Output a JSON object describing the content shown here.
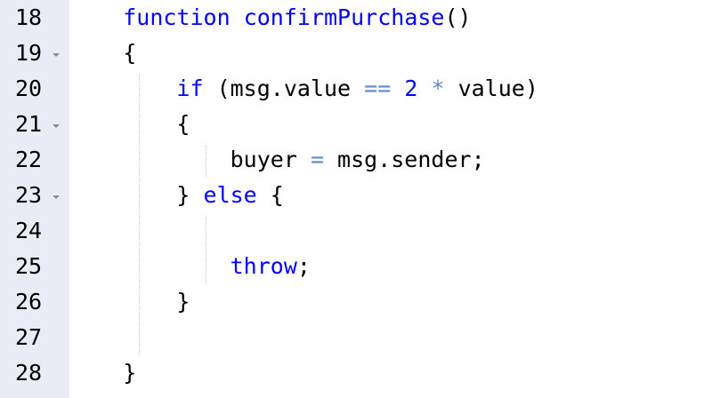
{
  "editor": {
    "colors": {
      "keyword": "#0000ff",
      "function_name": "#0000ff",
      "operator": "#5f8ac8",
      "number": "#0000ff",
      "plain": "#000000",
      "gutter_background": "#ebebf5",
      "fold_arrow": "#8c8c8c"
    },
    "lines": [
      {
        "number": "18",
        "fold": false,
        "tokens": [
          {
            "text": "    ",
            "type": "plain"
          },
          {
            "text": "function",
            "type": "keyword"
          },
          {
            "text": " ",
            "type": "plain"
          },
          {
            "text": "confirmPurchase",
            "type": "function_name"
          },
          {
            "text": "()",
            "type": "plain"
          }
        ]
      },
      {
        "number": "19",
        "fold": true,
        "tokens": [
          {
            "text": "    {",
            "type": "plain"
          }
        ]
      },
      {
        "number": "20",
        "fold": false,
        "tokens": [
          {
            "text": "        ",
            "type": "plain"
          },
          {
            "text": "if",
            "type": "keyword"
          },
          {
            "text": " (msg.value ",
            "type": "plain"
          },
          {
            "text": "==",
            "type": "operator"
          },
          {
            "text": " ",
            "type": "plain"
          },
          {
            "text": "2",
            "type": "number"
          },
          {
            "text": " ",
            "type": "plain"
          },
          {
            "text": "*",
            "type": "operator"
          },
          {
            "text": " value)",
            "type": "plain"
          }
        ]
      },
      {
        "number": "21",
        "fold": true,
        "tokens": [
          {
            "text": "        {",
            "type": "plain"
          }
        ]
      },
      {
        "number": "22",
        "fold": false,
        "tokens": [
          {
            "text": "            buyer ",
            "type": "plain"
          },
          {
            "text": "=",
            "type": "operator"
          },
          {
            "text": " msg.sender;",
            "type": "plain"
          }
        ]
      },
      {
        "number": "23",
        "fold": true,
        "tokens": [
          {
            "text": "        } ",
            "type": "plain"
          },
          {
            "text": "else",
            "type": "keyword"
          },
          {
            "text": " {",
            "type": "plain"
          }
        ]
      },
      {
        "number": "24",
        "fold": false,
        "tokens": []
      },
      {
        "number": "25",
        "fold": false,
        "tokens": [
          {
            "text": "            ",
            "type": "plain"
          },
          {
            "text": "throw",
            "type": "keyword"
          },
          {
            "text": ";",
            "type": "plain"
          }
        ]
      },
      {
        "number": "26",
        "fold": false,
        "tokens": [
          {
            "text": "        }",
            "type": "plain"
          }
        ]
      },
      {
        "number": "27",
        "fold": false,
        "tokens": []
      },
      {
        "number": "28",
        "fold": false,
        "tokens": [
          {
            "text": "    }",
            "type": "plain"
          }
        ]
      }
    ]
  }
}
